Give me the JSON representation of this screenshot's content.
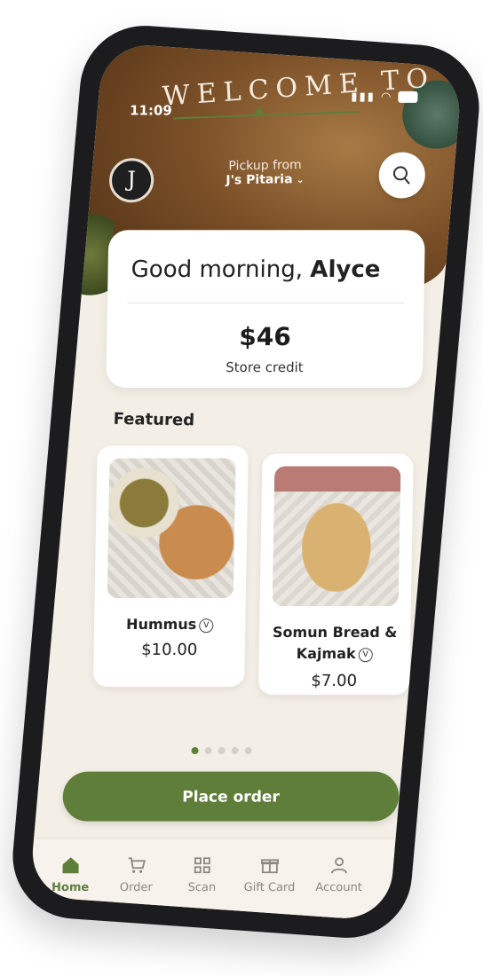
{
  "status": {
    "time": "11:09"
  },
  "hero": {
    "welcome_text": "WELCOME TO"
  },
  "header": {
    "pickup_label": "Pickup from",
    "store_name": "J's Pitaria",
    "logo_letter": "J"
  },
  "credit": {
    "greeting_prefix": "Good morning,",
    "user_name": "Alyce",
    "amount": "$46",
    "label": "Store credit"
  },
  "featured": {
    "title": "Featured",
    "items": [
      {
        "name": "Hummus",
        "price": "$10.00",
        "vegetarian_badge": "V"
      },
      {
        "name": "Somun Bread & Kajmak",
        "price": "$7.00",
        "vegetarian_badge": "V"
      }
    ],
    "carousel": {
      "count": 5,
      "active_index": 0
    }
  },
  "cta": {
    "place_order": "Place order"
  },
  "tabs": [
    {
      "label": "Home",
      "icon": "home-icon",
      "active": true
    },
    {
      "label": "Order",
      "icon": "cart-icon",
      "active": false
    },
    {
      "label": "Scan",
      "icon": "qr-scan-icon",
      "active": false
    },
    {
      "label": "Gift Card",
      "icon": "gift-icon",
      "active": false
    },
    {
      "label": "Account",
      "icon": "person-icon",
      "active": false
    }
  ],
  "colors": {
    "accent_green": "#5f7e3a",
    "background": "#f4efe6",
    "card": "#ffffff"
  }
}
